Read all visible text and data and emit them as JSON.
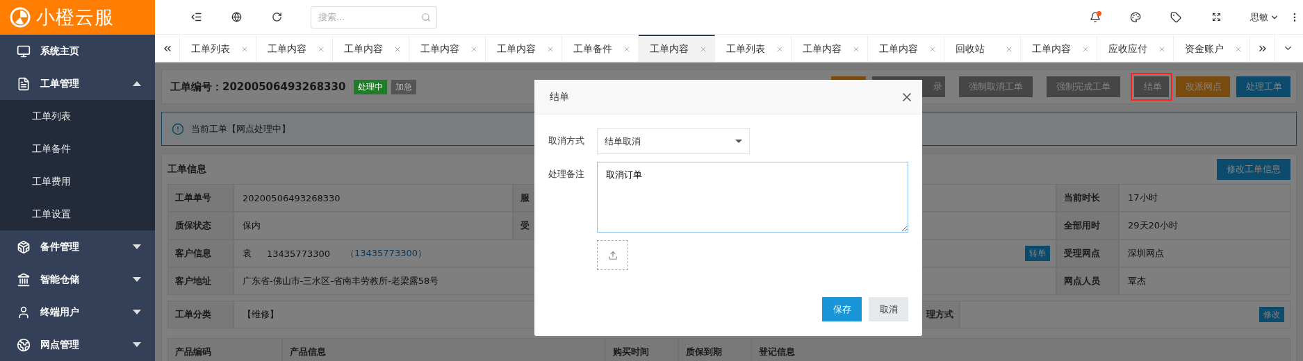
{
  "logo": {
    "text": "小橙云服"
  },
  "search": {
    "placeholder": "搜索..."
  },
  "notifications": {
    "unread": true
  },
  "user": {
    "name": "思敏"
  },
  "sidebar": {
    "items": [
      {
        "label": "系统主页",
        "kind": "link"
      },
      {
        "label": "工单管理",
        "kind": "group",
        "expanded": true,
        "children": [
          {
            "label": "工单列表"
          },
          {
            "label": "工单备件"
          },
          {
            "label": "工单费用"
          },
          {
            "label": "工单设置"
          }
        ]
      },
      {
        "label": "备件管理",
        "kind": "group",
        "expanded": false
      },
      {
        "label": "智能仓储",
        "kind": "group",
        "expanded": false
      },
      {
        "label": "终端用户",
        "kind": "group",
        "expanded": false
      },
      {
        "label": "网点管理",
        "kind": "group",
        "expanded": false
      }
    ]
  },
  "tabs": [
    {
      "label": "工单列表",
      "selected": false
    },
    {
      "label": "工单内容",
      "selected": false
    },
    {
      "label": "工单内容",
      "selected": false
    },
    {
      "label": "工单内容",
      "selected": false
    },
    {
      "label": "工单内容",
      "selected": false
    },
    {
      "label": "工单备件",
      "selected": false
    },
    {
      "label": "工单内容",
      "selected": true
    },
    {
      "label": "工单列表",
      "selected": false
    },
    {
      "label": "工单内容",
      "selected": false
    },
    {
      "label": "工单内容",
      "selected": false
    },
    {
      "label": "回收站",
      "selected": false
    },
    {
      "label": "工单内容",
      "selected": false
    },
    {
      "label": "应收应付",
      "selected": false
    },
    {
      "label": "资金账户",
      "selected": false
    }
  ],
  "header": {
    "title": "工单编号：20200506493268330",
    "badges": [
      {
        "label": "处理中",
        "color": "#1f7d2a"
      },
      {
        "label": "加急",
        "color": "#555555"
      }
    ],
    "actions": [
      {
        "kind": "warning",
        "highlighted": false
      },
      {
        "kind": "dark",
        "label": "录",
        "highlighted": false
      },
      {
        "kind": "dark",
        "label": "强制取消工单",
        "highlighted": false
      },
      {
        "kind": "dark",
        "label": "强制完成工单",
        "highlighted": false
      },
      {
        "kind": "dark",
        "label": "结单",
        "highlighted": true
      },
      {
        "kind": "warning",
        "label": "改派网点",
        "highlighted": false
      },
      {
        "kind": "primary",
        "label": "处理工单",
        "highlighted": false
      }
    ]
  },
  "alert": {
    "text": "当前工单【网点处理中】"
  },
  "info": {
    "title": "工单信息",
    "edit_button": "修改工单信息",
    "rows": [
      {
        "label": "工单单号",
        "value": "20200506493268330",
        "label_2": "服",
        "label_3": "当前时长",
        "value_3": "17小时"
      },
      {
        "label": "质保状态",
        "value": "保内",
        "label_2": "受",
        "label_3": "全部用时",
        "value_3": "29天20小时"
      },
      {
        "label": "客户信息",
        "value": "袁",
        "phone": "13435773300",
        "phone_link": "（13435773300）",
        "action": "转单",
        "label_3": "受理网点",
        "value_3": "深圳网点"
      },
      {
        "label": "客户地址",
        "value": "广东省-佛山市-三水区-省南丰劳教所-老梁露58号",
        "label_3": "网点人员",
        "value_3": "覃杰"
      }
    ],
    "category": {
      "label": "工单分类",
      "value": "【维修】",
      "label_2": "理方式",
      "button": "修改"
    }
  },
  "products": {
    "columns": [
      "产品编码",
      "产品信息",
      "购买时间",
      "质保到期",
      "登记信息"
    ]
  },
  "modal": {
    "title": "结单",
    "fields": [
      {
        "kind": "select",
        "label": "取消方式",
        "value": "结单取消"
      },
      {
        "kind": "textarea",
        "label": "处理备注",
        "value": "取消订单"
      }
    ],
    "buttons": [
      {
        "kind": "primary",
        "label": "保存"
      },
      {
        "kind": "default",
        "label": "取消"
      }
    ]
  }
}
